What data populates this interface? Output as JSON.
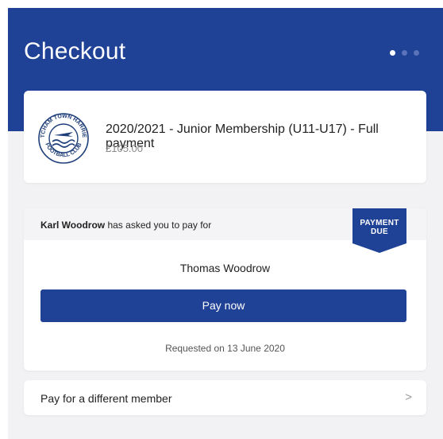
{
  "header": {
    "title": "Checkout",
    "steps_total": 3,
    "active_step": 1
  },
  "product": {
    "logo_text_top": "HATCHAM TOWN HARRIERS",
    "logo_text_bottom": "FOOTBALL CLUB",
    "name": "2020/2021 - Junior Membership (U11-U17) - Full payment",
    "price": "£105.00"
  },
  "request": {
    "requester": "Karl Woodrow",
    "request_suffix": " has asked you to pay for",
    "badge_line1": "PAYMENT",
    "badge_line2": "DUE",
    "member": "Thomas Woodrow",
    "pay_label": "Pay now",
    "requested_on": "Requested on 13 June 2020"
  },
  "other_member": {
    "label": "Pay for a different member",
    "chevron": ">"
  },
  "colors": {
    "brand": "#1f4196",
    "background": "#f2f2f4",
    "card": "#ffffff"
  }
}
